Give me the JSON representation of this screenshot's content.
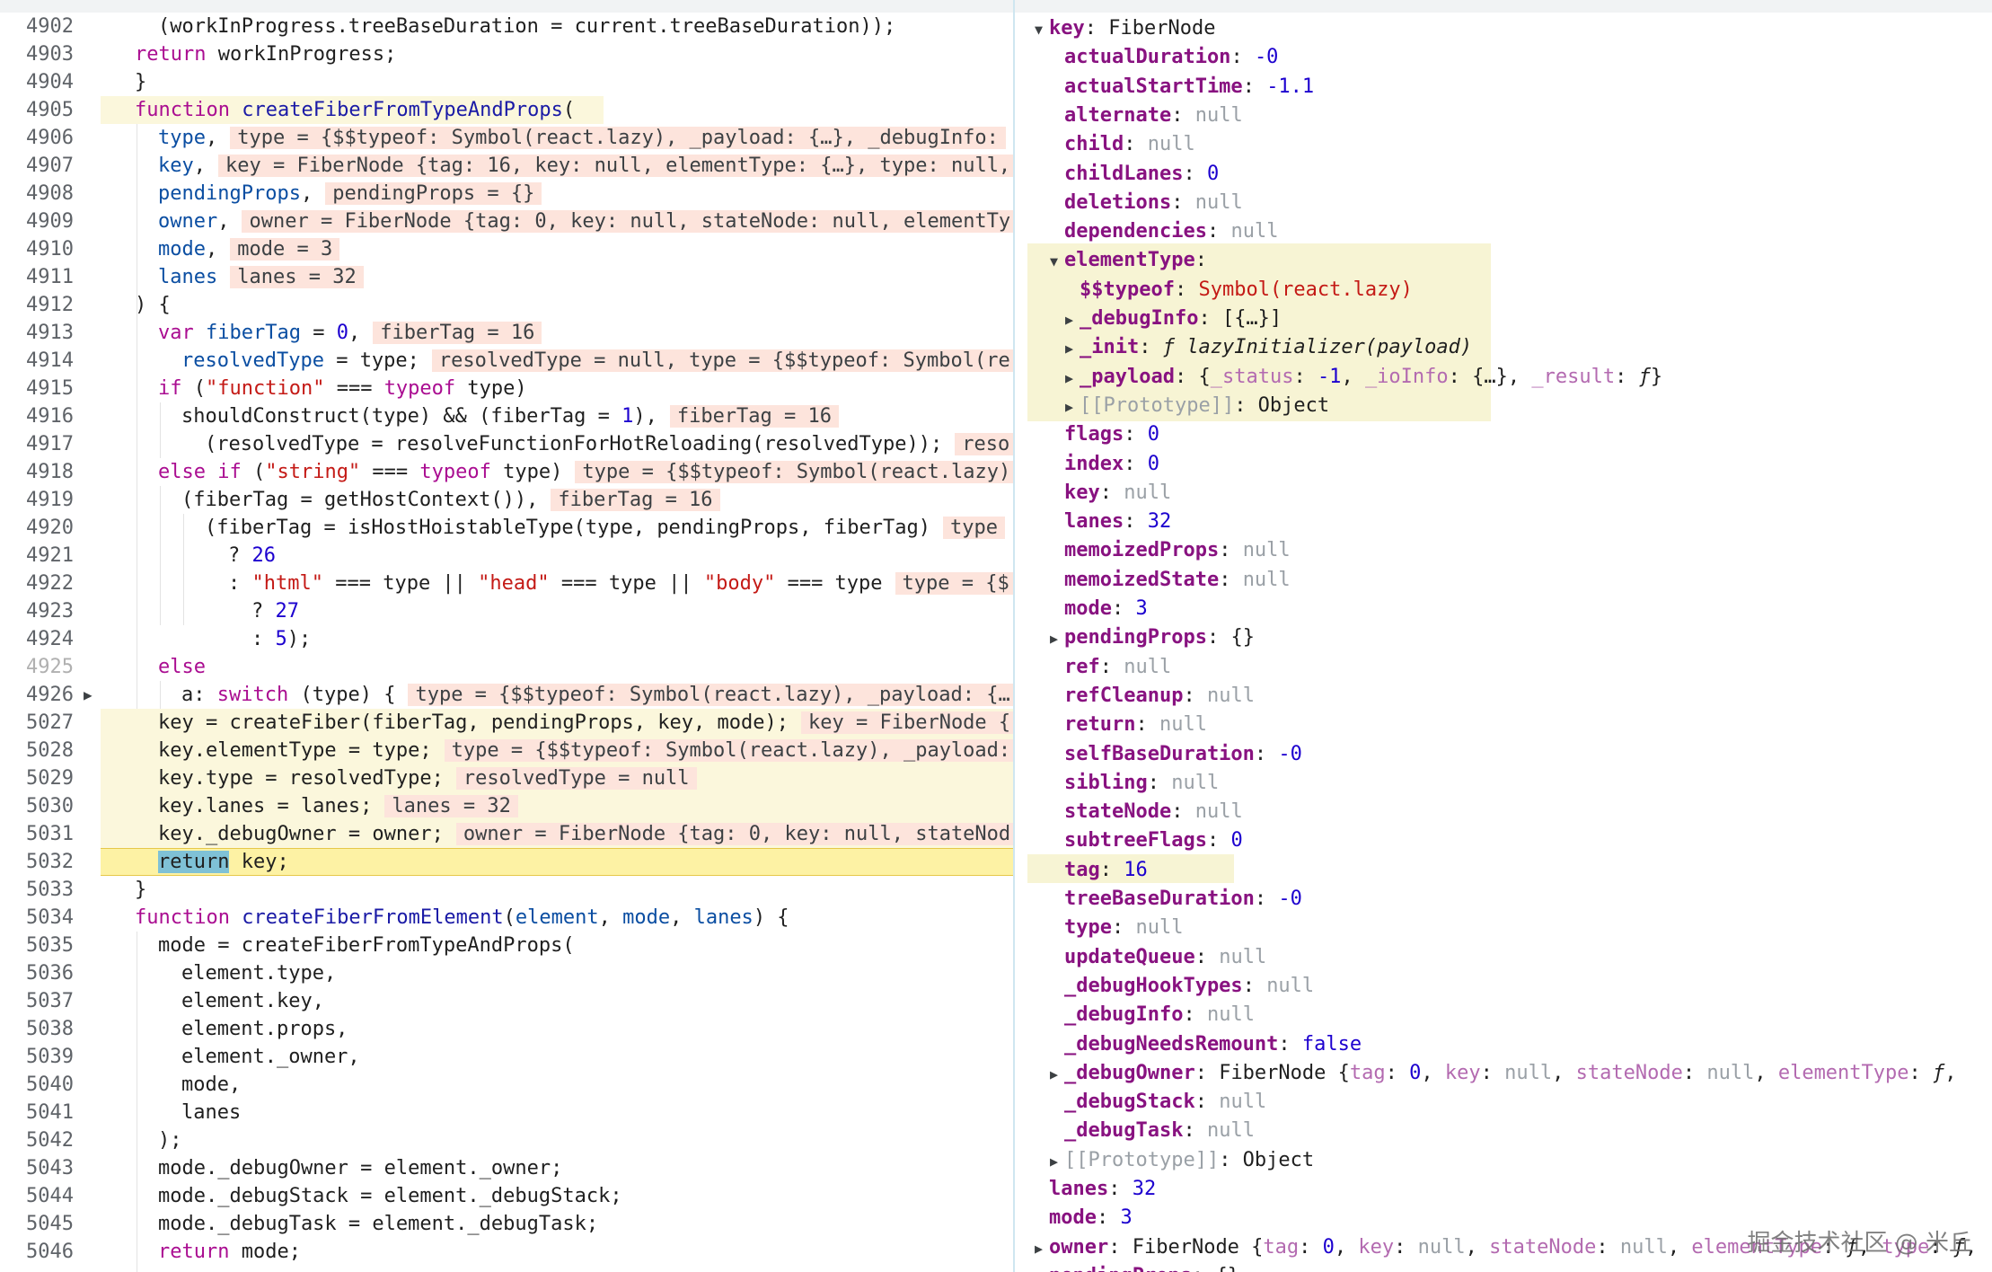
{
  "editor": {
    "lines": [
      {
        "num": "4902",
        "html": "  (workInProgress.treeBaseDuration = current.treeBaseDuration));"
      },
      {
        "num": "4903",
        "html": "<span class='kw'>return</span> workInProgress;"
      },
      {
        "num": "4904",
        "html": "}"
      },
      {
        "num": "4905",
        "html": "<span class='kw'>function</span> <span class='fn'>createFiberFromTypeAndProps</span>("
      },
      {
        "num": "4906",
        "html": "  <span class='pm'>type</span>,<span class='inl'>type = {$$typeof: Symbol(react.lazy), _payload: {…}, _debugInfo:</span>"
      },
      {
        "num": "4907",
        "html": "  <span class='pm'>key</span>,<span class='inl'>key = FiberNode {tag: 16, key: null, elementType: {…}, type: null,</span>"
      },
      {
        "num": "4908",
        "html": "  <span class='pm'>pendingProps</span>,<span class='inl'>pendingProps = {}</span>"
      },
      {
        "num": "4909",
        "html": "  <span class='pm'>owner</span>,<span class='inl'>owner = FiberNode {tag: 0, key: null, stateNode: null, elementTy</span>"
      },
      {
        "num": "4910",
        "html": "  <span class='pm'>mode</span>,<span class='inl'>mode = 3</span>"
      },
      {
        "num": "4911",
        "html": "  <span class='pm'>lanes</span><span class='inl'>lanes = 32</span>"
      },
      {
        "num": "4912",
        "html": ") {"
      },
      {
        "num": "4913",
        "html": "  <span class='kw'>var</span> <span class='pm'>fiberTag</span> = <span class='nu'>0</span>,<span class='inl'>fiberTag = 16</span>"
      },
      {
        "num": "4914",
        "html": "    <span class='pm'>resolvedType</span> = type;<span class='inl'>resolvedType = null, type = {$$typeof: Symbol(re</span>"
      },
      {
        "num": "4915",
        "html": "  <span class='kw'>if</span> (<span class='st'>\"function\"</span> === <span class='kw'>typeof</span> type)"
      },
      {
        "num": "4916",
        "html": "    shouldConstruct(type) &amp;&amp; (fiberTag = <span class='nu'>1</span>),<span class='inl'>fiberTag = 16</span>"
      },
      {
        "num": "4917",
        "html": "      (resolvedType = resolveFunctionForHotReloading(resolvedType));<span class='inl'>reso</span>"
      },
      {
        "num": "4918",
        "html": "  <span class='kw'>else if</span> (<span class='st'>\"string\"</span> === <span class='kw'>typeof</span> type)<span class='inl'>type = {$$typeof: Symbol(react.lazy)</span>"
      },
      {
        "num": "4919",
        "html": "    (fiberTag = getHostContext()),<span class='inl'>fiberTag = 16</span>"
      },
      {
        "num": "4920",
        "html": "      (fiberTag = isHostHoistableType(type, pendingProps, fiberTag)<span class='inl'>type</span>"
      },
      {
        "num": "4921",
        "html": "        ? <span class='nu'>26</span>"
      },
      {
        "num": "4922",
        "html": "        : <span class='st'>\"html\"</span> === type || <span class='st'>\"head\"</span> === type || <span class='st'>\"body\"</span> === type<span class='inl'>type = {$</span>"
      },
      {
        "num": "4923",
        "html": "          ? <span class='nu'>27</span>"
      },
      {
        "num": "4924",
        "html": "          : <span class='nu'>5</span>);"
      },
      {
        "num": "4925",
        "html": "  <span class='kw'>else</span>"
      },
      {
        "num": "4926",
        "html": "    a: <span class='kw'>switch</span> (type) {<span class='inl'>type = {$$typeof: Symbol(react.lazy), _payload: {…</span>"
      },
      {
        "num": "5027",
        "html": "  key = createFiber(fiberTag, pendingProps, key, mode);<span class='inl'>key = FiberNode {</span>"
      },
      {
        "num": "5028",
        "html": "  key.elementType = type;<span class='inl'>type = {$$typeof: Symbol(react.lazy), _payload:</span>"
      },
      {
        "num": "5029",
        "html": "  key.type = resolvedType;<span class='inl'>resolvedType = null</span>"
      },
      {
        "num": "5030",
        "html": "  key.lanes = lanes;<span class='inl'>lanes = 32</span>"
      },
      {
        "num": "5031",
        "html": "  key._debugOwner = owner;<span class='inl'>owner = FiberNode {tag: 0, key: null, stateNod</span>"
      },
      {
        "num": "5032",
        "html": "  <span class='kw rk'>return</span> key;"
      },
      {
        "num": "5033",
        "html": "}"
      },
      {
        "num": "5034",
        "html": "<span class='kw'>function</span> <span class='fn'>createFiberFromElement</span>(<span class='pm'>element</span>, <span class='pm'>mode</span>, <span class='pm'>lanes</span>) {"
      },
      {
        "num": "5035",
        "html": "  mode = createFiberFromTypeAndProps("
      },
      {
        "num": "5036",
        "html": "    element.type,"
      },
      {
        "num": "5037",
        "html": "    element.key,"
      },
      {
        "num": "5038",
        "html": "    element.props,"
      },
      {
        "num": "5039",
        "html": "    element._owner,"
      },
      {
        "num": "5040",
        "html": "    mode,"
      },
      {
        "num": "5041",
        "html": "    lanes"
      },
      {
        "num": "5042",
        "html": "  );"
      },
      {
        "num": "5043",
        "html": "  mode._debugOwner = element._owner;"
      },
      {
        "num": "5044",
        "html": "  mode._debugStack = element._debugStack;"
      },
      {
        "num": "5045",
        "html": "  mode._debugTask = element._debugTask;"
      },
      {
        "num": "5046",
        "html": "  <span class='kw'>return</span> mode;"
      }
    ]
  },
  "scope": {
    "rows": [
      {
        "tri": "down",
        "html": "<span class='prop'>key</span>: FiberNode"
      },
      {
        "html": "<span class='prop'>actualDuration</span>: <span class='snum'>-0</span>"
      },
      {
        "html": "<span class='prop'>actualStartTime</span>: <span class='snum'>-1.1</span>"
      },
      {
        "html": "<span class='prop'>alternate</span>: <span class='nul'>null</span>"
      },
      {
        "html": "<span class='prop'>child</span>: <span class='nul'>null</span>"
      },
      {
        "html": "<span class='prop'>childLanes</span>: <span class='snum'>0</span>"
      },
      {
        "html": "<span class='prop'>deletions</span>: <span class='nul'>null</span>"
      },
      {
        "html": "<span class='prop'>dependencies</span>: <span class='nul'>null</span>"
      },
      {
        "tri": "down",
        "html": "<span class='prop'>elementType</span>:"
      },
      {
        "html": "<span class='prop'>$$typeof</span>: <span class='sstr'>Symbol(react.lazy)</span>"
      },
      {
        "tri": "right",
        "html": "<span class='prop'>_debugInfo</span>: [{…}]"
      },
      {
        "tri": "right",
        "html": "<span class='prop'>_init</span>: <span class='sfn'>ƒ lazyInitializer(payload)</span>"
      },
      {
        "tri": "right",
        "html": "<span class='prop'>_payload</span>: {<span class='pfaint'>_status</span>: <span class='snum'>-1</span>, <span class='pfaint'>_ioInfo</span>: {…}, <span class='pfaint'>_result</span>: <span class='sfn'>ƒ</span>}"
      },
      {
        "tri": "right",
        "html": "<span class='nul'>[[Prototype]]</span>: Object"
      },
      {
        "html": "<span class='prop'>flags</span>: <span class='snum'>0</span>"
      },
      {
        "html": "<span class='prop'>index</span>: <span class='snum'>0</span>"
      },
      {
        "html": "<span class='prop'>key</span>: <span class='nul'>null</span>"
      },
      {
        "html": "<span class='prop'>lanes</span>: <span class='snum'>32</span>"
      },
      {
        "html": "<span class='prop'>memoizedProps</span>: <span class='nul'>null</span>"
      },
      {
        "html": "<span class='prop'>memoizedState</span>: <span class='nul'>null</span>"
      },
      {
        "html": "<span class='prop'>mode</span>: <span class='snum'>3</span>"
      },
      {
        "tri": "right",
        "html": "<span class='prop'>pendingProps</span>: {}"
      },
      {
        "html": "<span class='prop'>ref</span>: <span class='nul'>null</span>"
      },
      {
        "html": "<span class='prop'>refCleanup</span>: <span class='nul'>null</span>"
      },
      {
        "html": "<span class='prop'>return</span>: <span class='nul'>null</span>"
      },
      {
        "html": "<span class='prop'>selfBaseDuration</span>: <span class='snum'>-0</span>"
      },
      {
        "html": "<span class='prop'>sibling</span>: <span class='nul'>null</span>"
      },
      {
        "html": "<span class='prop'>stateNode</span>: <span class='nul'>null</span>"
      },
      {
        "html": "<span class='prop'>subtreeFlags</span>: <span class='snum'>0</span>"
      },
      {
        "html": "<span class='prop'>tag</span>: <span class='snum'>16</span>"
      },
      {
        "html": "<span class='prop'>treeBaseDuration</span>: <span class='snum'>-0</span>"
      },
      {
        "html": "<span class='prop'>type</span>: <span class='nul'>null</span>"
      },
      {
        "html": "<span class='prop'>updateQueue</span>: <span class='nul'>null</span>"
      },
      {
        "html": "<span class='prop'>_debugHookTypes</span>: <span class='nul'>null</span>"
      },
      {
        "html": "<span class='prop'>_debugInfo</span>: <span class='nul'>null</span>"
      },
      {
        "html": "<span class='prop'>_debugNeedsRemount</span>: <span class='snum'>false</span>"
      },
      {
        "tri": "right",
        "html": "<span class='prop'>_debugOwner</span>: FiberNode {<span class='pfaint'>tag</span>: <span class='snum'>0</span>, <span class='pfaint'>key</span>: <span class='nul'>null</span>, <span class='pfaint'>stateNode</span>: <span class='nul'>null</span>, <span class='pfaint'>elementType</span>: <span class='sfn'>ƒ</span>,"
      },
      {
        "html": "<span class='prop'>_debugStack</span>: <span class='nul'>null</span>"
      },
      {
        "html": "<span class='prop'>_debugTask</span>: <span class='nul'>null</span>"
      },
      {
        "tri": "right",
        "html": "<span class='nul'>[[Prototype]]</span>: Object"
      },
      {
        "html": "<span class='prop'>lanes</span>: <span class='snum'>32</span>"
      },
      {
        "html": "<span class='prop'>mode</span>: <span class='snum'>3</span>"
      },
      {
        "tri": "right",
        "html": "<span class='prop'>owner</span>: FiberNode {<span class='pfaint'>tag</span>: <span class='snum'>0</span>, <span class='pfaint'>key</span>: <span class='nul'>null</span>, <span class='pfaint'>stateNode</span>: <span class='nul'>null</span>, <span class='pfaint'>elementType</span>: <span class='sfn'>ƒ</span>, <span class='pfaint'>type</span>: <span class='sfn'>ƒ</span>,"
      },
      {
        "tri": "right",
        "html": "<span class='prop'>pendingProps</span>: {}"
      }
    ]
  },
  "watermark": "掘金技术社区 @ 米丘"
}
